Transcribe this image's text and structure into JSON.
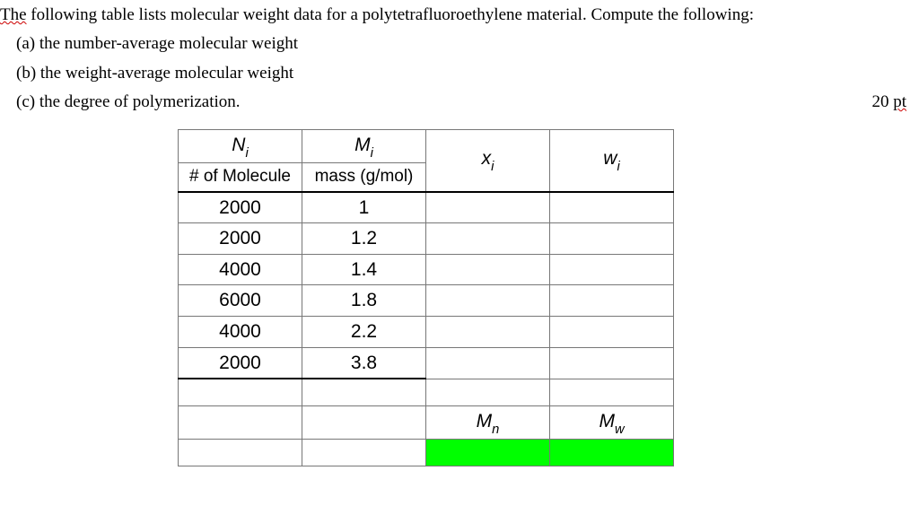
{
  "intro_underlined": "The",
  "intro_rest": " following table lists molecular weight data for a polytetrafluoroethylene material. Compute the following:",
  "part_a": "(a) the number-average molecular weight",
  "part_b": "(b) the weight-average molecular weight",
  "part_c": "(c) the degree of polymerization.",
  "points_num": "20 ",
  "points_unit": "pt",
  "headers": {
    "col1_sym": "N",
    "col1_sub": "i",
    "col1_lbl": "# of Molecule",
    "col2_sym": "M",
    "col2_sub": "i",
    "col2_lbl": "mass (g/mol)",
    "col3_sym": "x",
    "col3_sub": "i",
    "col4_sym": "w",
    "col4_sub": "i"
  },
  "rows": [
    {
      "n": "2000",
      "m": "1"
    },
    {
      "n": "2000",
      "m": "1.2"
    },
    {
      "n": "4000",
      "m": "1.4"
    },
    {
      "n": "6000",
      "m": "1.8"
    },
    {
      "n": "4000",
      "m": "2.2"
    },
    {
      "n": "2000",
      "m": "3.8"
    }
  ],
  "footer": {
    "mn_sym": "M",
    "mn_sub": "n",
    "mw_sym": "M",
    "mw_sub": "w"
  }
}
